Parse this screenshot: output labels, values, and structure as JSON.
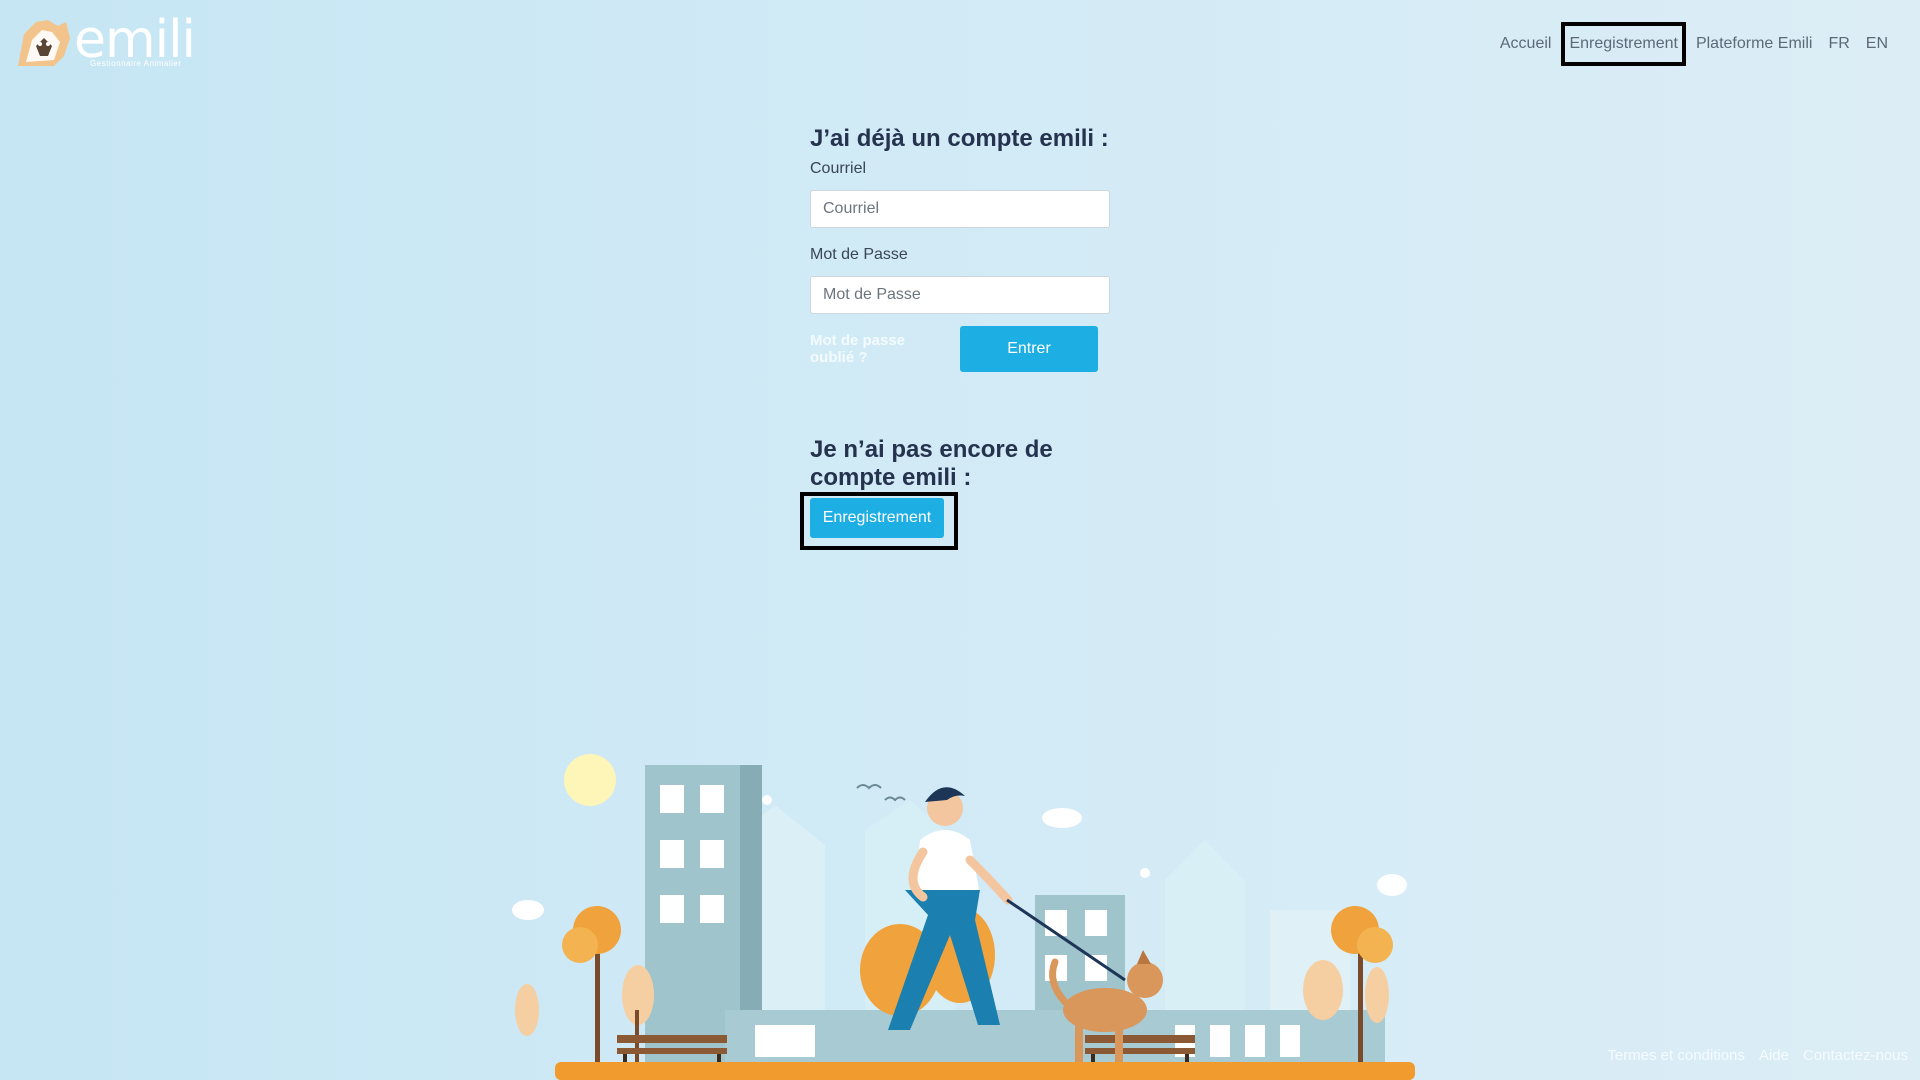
{
  "brand": {
    "name": "emili",
    "tagline": "Gestionnaire Animalier"
  },
  "nav": {
    "items": [
      {
        "label": "Accueil"
      },
      {
        "label": "Enregistrement"
      },
      {
        "label": "Plateforme Emili"
      },
      {
        "label": "FR"
      },
      {
        "label": "EN"
      }
    ]
  },
  "login": {
    "title": "J’ai déjà un compte emili :",
    "email_label": "Courriel",
    "email_placeholder": "Courriel",
    "password_label": "Mot de Passe",
    "password_placeholder": "Mot de Passe",
    "forgot_label": "Mot de passe oublié ?",
    "submit_label": "Entrer"
  },
  "register": {
    "title": "Je n’ai pas encore de compte emili :",
    "button_label": "Enregistrement"
  },
  "footer": {
    "terms": "Termes et conditions",
    "help": "Aide",
    "contact": "Contactez-nous"
  },
  "colors": {
    "accent": "#1daee3",
    "heading": "#26334f",
    "background": "#cbe8f5"
  }
}
